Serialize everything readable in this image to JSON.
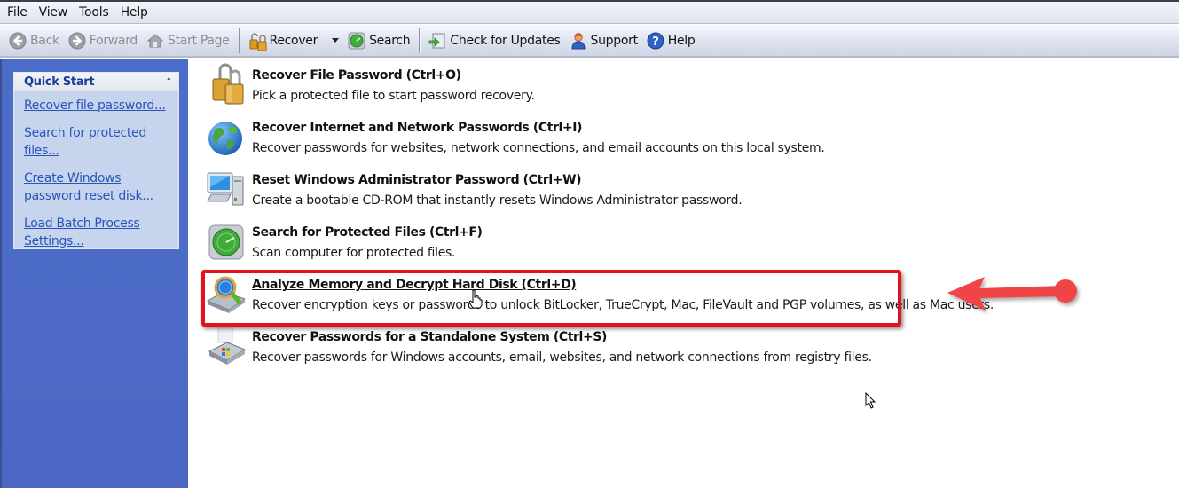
{
  "menubar": {
    "items": [
      "File",
      "View",
      "Tools",
      "Help"
    ]
  },
  "toolbar": {
    "back_label": "Back",
    "forward_label": "Forward",
    "start_page_label": "Start Page",
    "recover_label": "Recover",
    "search_label": "Search",
    "check_updates_label": "Check for Updates",
    "support_label": "Support",
    "help_label": "Help"
  },
  "sidebar": {
    "quick_start": {
      "title": "Quick Start",
      "collapse_glyph": "˄˄",
      "links": [
        "Recover file password...",
        "Search for protected files...",
        "Create Windows password reset disk...",
        "Load Batch Process Settings..."
      ]
    }
  },
  "tasks": [
    {
      "icon": "padlock-icon",
      "title": "Recover File Password (Ctrl+O)",
      "description": "Pick a protected file to start password recovery."
    },
    {
      "icon": "globe-icon",
      "title": "Recover Internet and Network Passwords (Ctrl+I)",
      "description": "Recover passwords for websites, network connections, and email accounts on this local system."
    },
    {
      "icon": "computer-icon",
      "title": "Reset Windows Administrator Password (Ctrl+W)",
      "description": "Create a bootable CD-ROM that instantly resets Windows Administrator password."
    },
    {
      "icon": "radar-search-icon",
      "title": "Search for Protected Files (Ctrl+F)",
      "description": "Scan computer for protected files."
    },
    {
      "icon": "disk-magnifier-icon",
      "title": "Analyze Memory and Decrypt Hard Disk (Ctrl+D)",
      "description": "Recover encryption keys or passwords to unlock BitLocker, TrueCrypt, Mac, FileVault and PGP volumes, as well as Mac users."
    },
    {
      "icon": "registry-drive-icon",
      "title": "Recover Passwords for a Standalone System (Ctrl+S)",
      "description": "Recover passwords for Windows accounts, email, websites, and network connections from registry files."
    }
  ],
  "annotation": {
    "highlight_color": "#e4121b",
    "arrow_color": "#f04447",
    "highlighted_task": "Analyze Memory and Decrypt Hard Disk (Ctrl+D)"
  },
  "colors": {
    "sidebar_bg": "#4a6dc9",
    "panel_bg": "#c7d4ee",
    "link": "#2a55b8",
    "panel_title": "#173c9b"
  }
}
